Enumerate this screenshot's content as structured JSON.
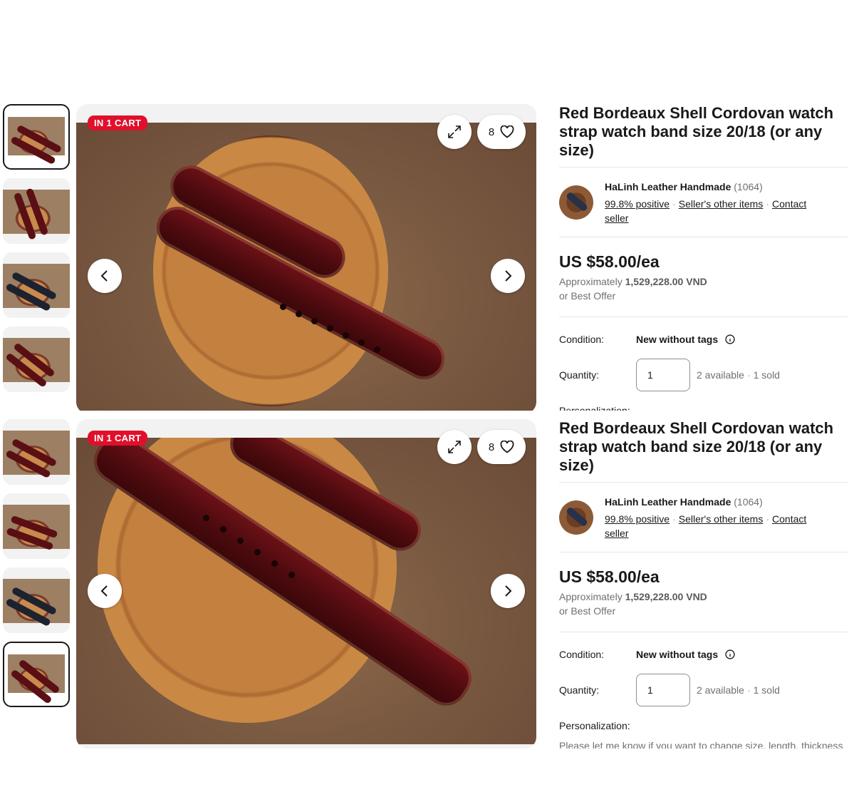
{
  "listing": {
    "badge": "IN 1 CART",
    "watch_count": "8",
    "title": "Red Bordeaux Shell Cordovan watch strap watch band size 20/18 (or any size)",
    "seller": {
      "name": "HaLinh Leather Handmade",
      "feedback_count": "(1064)",
      "positive": "99.8% positive",
      "other_items": "Seller's other items",
      "contact": "Contact seller"
    },
    "price": "US $58.00/ea",
    "approx_prefix": "Approximately",
    "approx_value": "1,529,228.00 VND",
    "best_offer": "or Best Offer",
    "condition_label": "Condition:",
    "condition_value": "New without tags",
    "quantity_label": "Quantity:",
    "quantity_value": "1",
    "available": "2 available",
    "sold": "1 sold",
    "personalization_label": "Personalization:",
    "personalization_note": "Please let me know if you want to change size, length, thickness"
  },
  "icons": {
    "expand": "expand-icon",
    "heart": "heart-icon",
    "prev": "chevron-left-icon",
    "next": "chevron-right-icon",
    "info": "info-icon"
  },
  "colors": {
    "badge_red": "#e0102b",
    "text": "#191919",
    "muted": "#707070"
  }
}
